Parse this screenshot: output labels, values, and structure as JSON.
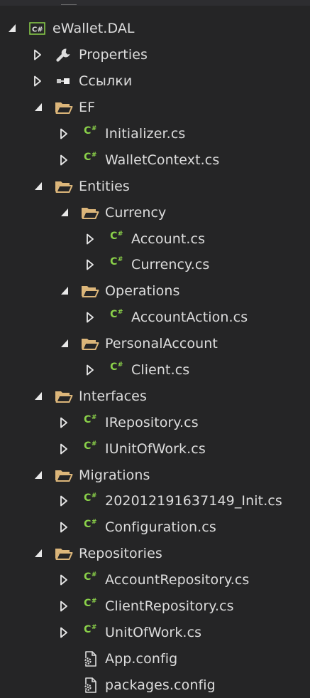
{
  "solution_explorer": {
    "items": [
      {
        "label": "eWallet.DAL",
        "depth": 0,
        "expander": "expanded",
        "icon": "csharp-project-icon"
      },
      {
        "label": "Properties",
        "depth": 1,
        "expander": "collapsed",
        "icon": "wrench-icon"
      },
      {
        "label": "Ссылки",
        "depth": 1,
        "expander": "collapsed",
        "icon": "references-icon"
      },
      {
        "label": "EF",
        "depth": 1,
        "expander": "expanded",
        "icon": "folder-open-icon"
      },
      {
        "label": "Initializer.cs",
        "depth": 2,
        "expander": "collapsed",
        "icon": "csharp-file-icon"
      },
      {
        "label": "WalletContext.cs",
        "depth": 2,
        "expander": "collapsed",
        "icon": "csharp-file-icon"
      },
      {
        "label": "Entities",
        "depth": 1,
        "expander": "expanded",
        "icon": "folder-open-icon"
      },
      {
        "label": "Currency",
        "depth": 2,
        "expander": "expanded",
        "icon": "folder-open-icon"
      },
      {
        "label": "Account.cs",
        "depth": 3,
        "expander": "collapsed",
        "icon": "csharp-file-icon"
      },
      {
        "label": "Currency.cs",
        "depth": 3,
        "expander": "collapsed",
        "icon": "csharp-file-icon"
      },
      {
        "label": "Operations",
        "depth": 2,
        "expander": "expanded",
        "icon": "folder-open-icon"
      },
      {
        "label": "AccountAction.cs",
        "depth": 3,
        "expander": "collapsed",
        "icon": "csharp-file-icon"
      },
      {
        "label": "PersonalAccount",
        "depth": 2,
        "expander": "expanded",
        "icon": "folder-open-icon"
      },
      {
        "label": "Client.cs",
        "depth": 3,
        "expander": "collapsed",
        "icon": "csharp-file-icon"
      },
      {
        "label": "Interfaces",
        "depth": 1,
        "expander": "expanded",
        "icon": "folder-open-icon"
      },
      {
        "label": "IRepository.cs",
        "depth": 2,
        "expander": "collapsed",
        "icon": "csharp-file-icon"
      },
      {
        "label": "IUnitOfWork.cs",
        "depth": 2,
        "expander": "collapsed",
        "icon": "csharp-file-icon"
      },
      {
        "label": "Migrations",
        "depth": 1,
        "expander": "expanded",
        "icon": "folder-open-icon"
      },
      {
        "label": "202012191637149_Init.cs",
        "depth": 2,
        "expander": "collapsed",
        "icon": "csharp-file-icon"
      },
      {
        "label": "Configuration.cs",
        "depth": 2,
        "expander": "collapsed",
        "icon": "csharp-file-icon"
      },
      {
        "label": "Repositories",
        "depth": 1,
        "expander": "expanded",
        "icon": "folder-open-icon"
      },
      {
        "label": "AccountRepository.cs",
        "depth": 2,
        "expander": "collapsed",
        "icon": "csharp-file-icon"
      },
      {
        "label": "ClientRepository.cs",
        "depth": 2,
        "expander": "collapsed",
        "icon": "csharp-file-icon"
      },
      {
        "label": "UnitOfWork.cs",
        "depth": 2,
        "expander": "collapsed",
        "icon": "csharp-file-icon"
      },
      {
        "label": "App.config",
        "depth": 2,
        "expander": "none",
        "icon": "config-file-icon"
      },
      {
        "label": "packages.config",
        "depth": 2,
        "expander": "none",
        "icon": "config-file-icon"
      }
    ]
  },
  "colors": {
    "background": "#252526",
    "text": "#dcdcdc",
    "csharp_green": "#8bd24a",
    "folder_gold": "#dcb67a",
    "project_border": "#8bd24a"
  }
}
